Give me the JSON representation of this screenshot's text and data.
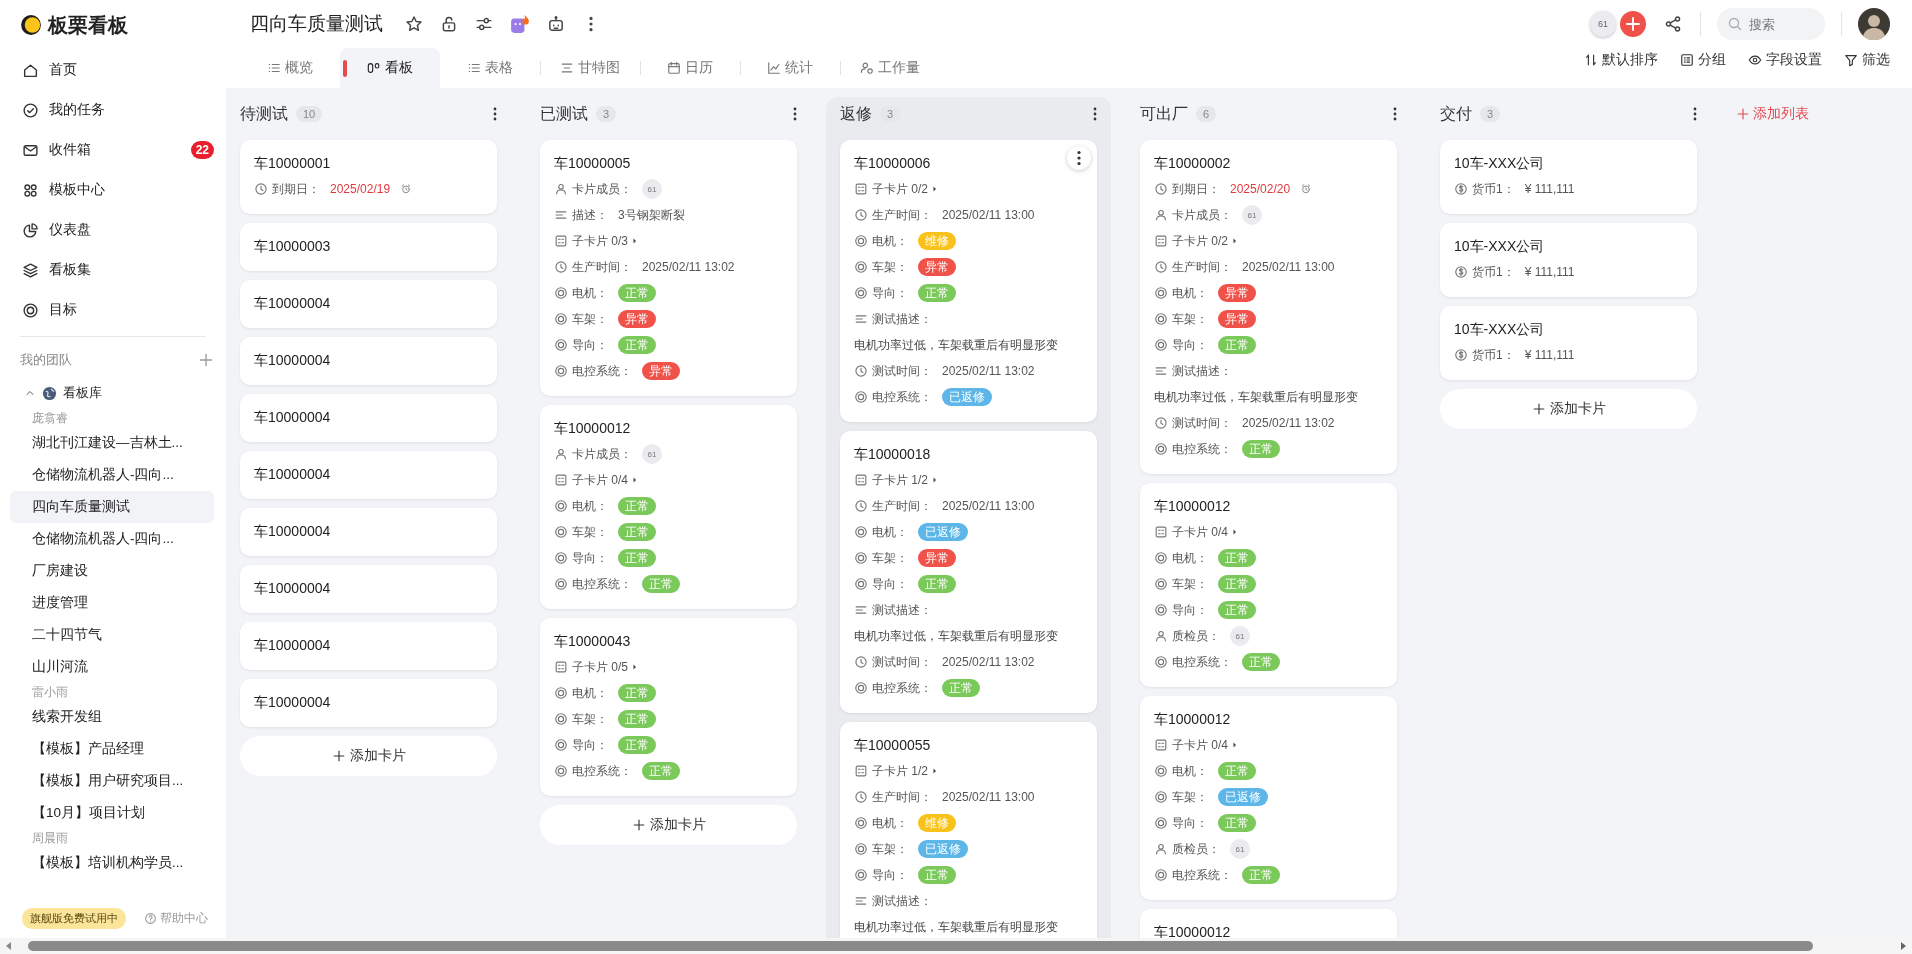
{
  "app": {
    "name": "板栗看板"
  },
  "nav": [
    {
      "label": "首页"
    },
    {
      "label": "我的任务"
    },
    {
      "label": "收件箱",
      "badge": "22"
    },
    {
      "label": "模板中心"
    },
    {
      "label": "仪表盘"
    },
    {
      "label": "看板集"
    },
    {
      "label": "目标"
    }
  ],
  "team": {
    "title": "我的团队",
    "folder": {
      "label": "看板库",
      "expanded": true,
      "children": [
        {
          "kind": "owner",
          "label": "庞翕睿"
        },
        {
          "kind": "board",
          "label": "湖北刊江建设—吉林土...",
          "selected": false
        },
        {
          "kind": "board",
          "label": "仓储物流机器人-四向...",
          "selected": false
        },
        {
          "kind": "board",
          "label": "四向车质量测试",
          "selected": true
        },
        {
          "kind": "board",
          "label": "仓储物流机器人-四向...",
          "selected": false
        },
        {
          "kind": "board",
          "label": "厂房建设",
          "selected": false
        },
        {
          "kind": "board",
          "label": "进度管理",
          "selected": false
        },
        {
          "kind": "board",
          "label": "二十四节气",
          "selected": false
        },
        {
          "kind": "board",
          "label": "山川河流",
          "selected": false
        },
        {
          "kind": "owner",
          "label": "雷小雨"
        },
        {
          "kind": "board",
          "label": "线索开发组",
          "selected": false
        },
        {
          "kind": "board",
          "label": "【模板】产品经理",
          "selected": false
        },
        {
          "kind": "board",
          "label": "【模板】用户研究项目...",
          "selected": false
        },
        {
          "kind": "board",
          "label": "【10月】项目计划",
          "selected": false
        },
        {
          "kind": "owner",
          "label": "周晨雨"
        },
        {
          "kind": "board",
          "label": "【模板】培训机构学员...",
          "selected": false
        }
      ]
    }
  },
  "footer": {
    "trial_badge": "旗舰版免费试用中",
    "help": "帮助中心"
  },
  "header": {
    "title": "四向车质量测试",
    "member_count": "61",
    "search": {
      "placeholder": "搜索"
    }
  },
  "tabs": [
    {
      "label": "概览",
      "selected": false
    },
    {
      "label": "看板",
      "selected": true
    },
    {
      "label": "表格",
      "selected": false
    },
    {
      "label": "甘特图",
      "selected": false
    },
    {
      "label": "日历",
      "selected": false
    },
    {
      "label": "统计",
      "selected": false
    },
    {
      "label": "工作量",
      "selected": false
    }
  ],
  "toolbar": [
    "默认排序",
    "分组",
    "字段设置",
    "筛选"
  ],
  "columns": [
    {
      "title": "待测试",
      "count": "10",
      "highlighted": false,
      "add_card": "添加卡片",
      "cards": [
        {
          "title": "车10000001",
          "hovered": false,
          "fields": [
            {
              "kind": "due",
              "label": "到期日：",
              "value": "2025/02/19"
            }
          ]
        },
        {
          "title": "车10000003",
          "hovered": false
        },
        {
          "title": "车10000004",
          "hovered": false
        },
        {
          "title": "车10000004",
          "hovered": false
        },
        {
          "title": "车10000004",
          "hovered": false
        },
        {
          "title": "车10000004",
          "hovered": false
        },
        {
          "title": "车10000004",
          "hovered": false
        },
        {
          "title": "车10000004",
          "hovered": false
        },
        {
          "title": "车10000004",
          "hovered": false
        },
        {
          "title": "车10000004",
          "hovered": false
        }
      ]
    },
    {
      "title": "已测试",
      "count": "3",
      "highlighted": false,
      "add_card": "添加卡片",
      "cards": [
        {
          "title": "车10000005",
          "hovered": false,
          "fields": [
            {
              "kind": "member",
              "label": "卡片成员：",
              "value": "61"
            },
            {
              "kind": "text",
              "label": "描述：",
              "value": "3号钢架断裂"
            },
            {
              "kind": "sub",
              "value": "子卡片 0/3"
            },
            {
              "kind": "time",
              "label": "生产时间：",
              "value": "2025/02/11 13:02"
            },
            {
              "kind": "status",
              "label": "电机：",
              "value": "正常",
              "color": "#7cc95b"
            },
            {
              "kind": "status",
              "label": "车架：",
              "value": "异常",
              "color": "#f0524a"
            },
            {
              "kind": "status",
              "label": "导向：",
              "value": "正常",
              "color": "#7cc95b"
            },
            {
              "kind": "status",
              "label": "电控系统：",
              "value": "异常",
              "color": "#f0524a"
            }
          ]
        },
        {
          "title": "车10000012",
          "hovered": false,
          "fields": [
            {
              "kind": "member",
              "label": "卡片成员：",
              "value": "61"
            },
            {
              "kind": "sub",
              "value": "子卡片 0/4"
            },
            {
              "kind": "status",
              "label": "电机：",
              "value": "正常",
              "color": "#7cc95b"
            },
            {
              "kind": "status",
              "label": "车架：",
              "value": "正常",
              "color": "#7cc95b"
            },
            {
              "kind": "status",
              "label": "导向：",
              "value": "正常",
              "color": "#7cc95b"
            },
            {
              "kind": "status",
              "label": "电控系统：",
              "value": "正常",
              "color": "#7cc95b"
            }
          ]
        },
        {
          "title": "车10000043",
          "hovered": false,
          "fields": [
            {
              "kind": "sub",
              "value": "子卡片 0/5"
            },
            {
              "kind": "status",
              "label": "电机：",
              "value": "正常",
              "color": "#7cc95b"
            },
            {
              "kind": "status",
              "label": "车架：",
              "value": "正常",
              "color": "#7cc95b"
            },
            {
              "kind": "status",
              "label": "导向：",
              "value": "正常",
              "color": "#7cc95b"
            },
            {
              "kind": "status",
              "label": "电控系统：",
              "value": "正常",
              "color": "#7cc95b"
            }
          ]
        }
      ]
    },
    {
      "title": "返修",
      "count": "3",
      "highlighted": true,
      "cards": [
        {
          "title": "车10000006",
          "hovered": true,
          "fields": [
            {
              "kind": "sub",
              "value": "子卡片 0/2"
            },
            {
              "kind": "time",
              "label": "生产时间：",
              "value": "2025/02/11 13:00"
            },
            {
              "kind": "status",
              "label": "电机：",
              "value": "维修",
              "color": "#f9c21b"
            },
            {
              "kind": "status",
              "label": "车架：",
              "value": "异常",
              "color": "#f0524a"
            },
            {
              "kind": "status",
              "label": "导向：",
              "value": "正常",
              "color": "#7cc95b"
            },
            {
              "kind": "note",
              "label": "测试描述：",
              "value": "电机功率过低，车架载重后有明显形变"
            },
            {
              "kind": "time",
              "label": "测试时间：",
              "value": "2025/02/11 13:02"
            },
            {
              "kind": "status",
              "label": "电控系统：",
              "value": "已返修",
              "color": "#5db6e8"
            }
          ]
        },
        {
          "title": "车10000018",
          "hovered": false,
          "fields": [
            {
              "kind": "sub",
              "value": "子卡片 1/2"
            },
            {
              "kind": "time",
              "label": "生产时间：",
              "value": "2025/02/11 13:00"
            },
            {
              "kind": "status",
              "label": "电机：",
              "value": "已返修",
              "color": "#5db6e8"
            },
            {
              "kind": "status",
              "label": "车架：",
              "value": "异常",
              "color": "#f0524a"
            },
            {
              "kind": "status",
              "label": "导向：",
              "value": "正常",
              "color": "#7cc95b"
            },
            {
              "kind": "note",
              "label": "测试描述：",
              "value": "电机功率过低，车架载重后有明显形变"
            },
            {
              "kind": "time",
              "label": "测试时间：",
              "value": "2025/02/11 13:02"
            },
            {
              "kind": "status",
              "label": "电控系统：",
              "value": "正常",
              "color": "#7cc95b"
            }
          ]
        },
        {
          "title": "车10000055",
          "hovered": false,
          "fields": [
            {
              "kind": "sub",
              "value": "子卡片 1/2"
            },
            {
              "kind": "time",
              "label": "生产时间：",
              "value": "2025/02/11 13:00"
            },
            {
              "kind": "status",
              "label": "电机：",
              "value": "维修",
              "color": "#f9c21b"
            },
            {
              "kind": "status",
              "label": "车架：",
              "value": "已返修",
              "color": "#5db6e8"
            },
            {
              "kind": "status",
              "label": "导向：",
              "value": "正常",
              "color": "#7cc95b"
            },
            {
              "kind": "note",
              "label": "测试描述：",
              "value": "电机功率过低，车架载重后有明显形变"
            }
          ]
        }
      ]
    },
    {
      "title": "可出厂",
      "count": "6",
      "highlighted": false,
      "cards": [
        {
          "title": "车10000002",
          "hovered": false,
          "fields": [
            {
              "kind": "due",
              "label": "到期日：",
              "value": "2025/02/20"
            },
            {
              "kind": "member",
              "label": "卡片成员：",
              "value": "61"
            },
            {
              "kind": "sub",
              "value": "子卡片 0/2"
            },
            {
              "kind": "time",
              "label": "生产时间：",
              "value": "2025/02/11 13:00"
            },
            {
              "kind": "status",
              "label": "电机：",
              "value": "异常",
              "color": "#f0524a"
            },
            {
              "kind": "status",
              "label": "车架：",
              "value": "异常",
              "color": "#f0524a"
            },
            {
              "kind": "status",
              "label": "导向：",
              "value": "正常",
              "color": "#7cc95b"
            },
            {
              "kind": "note",
              "label": "测试描述：",
              "value": "电机功率过低，车架载重后有明显形变"
            },
            {
              "kind": "time",
              "label": "测试时间：",
              "value": "2025/02/11 13:02"
            },
            {
              "kind": "status",
              "label": "电控系统：",
              "value": "正常",
              "color": "#7cc95b"
            }
          ]
        },
        {
          "title": "车10000012",
          "hovered": false,
          "fields": [
            {
              "kind": "sub",
              "value": "子卡片 0/4"
            },
            {
              "kind": "status",
              "label": "电机：",
              "value": "正常",
              "color": "#7cc95b"
            },
            {
              "kind": "status",
              "label": "车架：",
              "value": "正常",
              "color": "#7cc95b"
            },
            {
              "kind": "status",
              "label": "导向：",
              "value": "正常",
              "color": "#7cc95b"
            },
            {
              "kind": "member",
              "label": "质检员：",
              "value": "61"
            },
            {
              "kind": "status",
              "label": "电控系统：",
              "value": "正常",
              "color": "#7cc95b"
            }
          ]
        },
        {
          "title": "车10000012",
          "hovered": false,
          "fields": [
            {
              "kind": "sub",
              "value": "子卡片 0/4"
            },
            {
              "kind": "status",
              "label": "电机：",
              "value": "正常",
              "color": "#7cc95b"
            },
            {
              "kind": "status",
              "label": "车架：",
              "value": "已返修",
              "color": "#5db6e8"
            },
            {
              "kind": "status",
              "label": "导向：",
              "value": "正常",
              "color": "#7cc95b"
            },
            {
              "kind": "member",
              "label": "质检员：",
              "value": "61"
            },
            {
              "kind": "status",
              "label": "电控系统：",
              "value": "正常",
              "color": "#7cc95b"
            }
          ]
        },
        {
          "title": "车10000012",
          "hovered": false
        }
      ]
    },
    {
      "title": "交付",
      "count": "3",
      "highlighted": false,
      "add_card": "添加卡片",
      "cards": [
        {
          "title": "10车-XXX公司",
          "hovered": false,
          "fields": [
            {
              "kind": "money",
              "label": "货币1：",
              "value": "¥ 111,111"
            }
          ]
        },
        {
          "title": "10车-XXX公司",
          "hovered": false,
          "fields": [
            {
              "kind": "money",
              "label": "货币1：",
              "value": "¥ 111,111"
            }
          ]
        },
        {
          "title": "10车-XXX公司",
          "hovered": false,
          "fields": [
            {
              "kind": "money",
              "label": "货币1：",
              "value": "¥ 111,111"
            }
          ]
        }
      ]
    }
  ],
  "add_list": "添加列表"
}
